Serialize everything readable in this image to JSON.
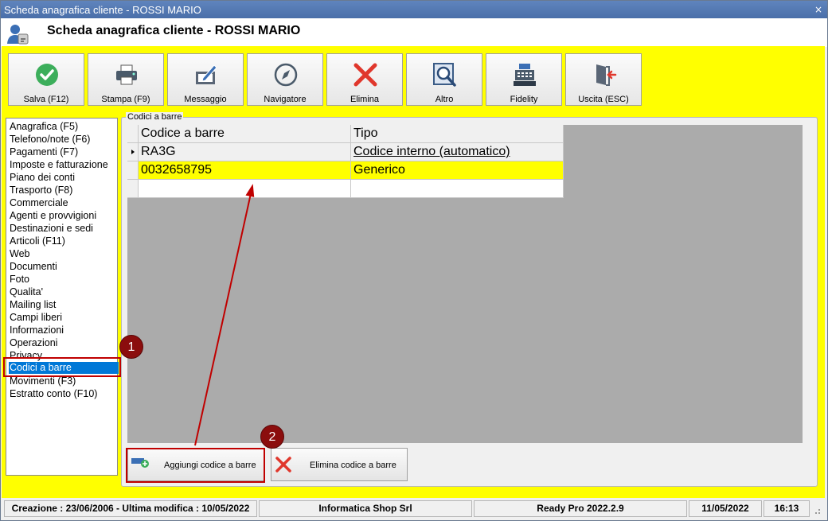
{
  "window": {
    "title": "Scheda anagrafica cliente - ROSSI MARIO",
    "close_glyph": "×"
  },
  "header": {
    "title": "Scheda anagrafica cliente - ROSSI MARIO"
  },
  "toolbar": {
    "save": "Salva (F12)",
    "print": "Stampa (F9)",
    "message": "Messaggio",
    "navigator": "Navigatore",
    "delete": "Elimina",
    "other": "Altro",
    "fidelity": "Fidelity",
    "exit": "Uscita (ESC)"
  },
  "menu": {
    "items": [
      "Anagrafica (F5)",
      "Telefono/note (F6)",
      "Pagamenti (F7)",
      "Imposte e fatturazione",
      "Piano dei conti",
      "Trasporto (F8)",
      "Commerciale",
      "Agenti e provvigioni",
      "Destinazioni e sedi",
      "Articoli (F11)",
      "Web",
      "Documenti",
      "Foto",
      "Qualita'",
      "Mailing list",
      "Campi liberi",
      "Informazioni",
      "Operazioni",
      "Privacy",
      "Codici a barre",
      "Movimenti (F3)",
      "Estratto conto (F10)"
    ],
    "selected_index": 19
  },
  "panel": {
    "group_label": "Codici a barre",
    "columns": [
      "Codice a barre",
      "Tipo"
    ],
    "rows": [
      {
        "code": "RA3G",
        "type": "Codice interno (automatico)"
      },
      {
        "code": "0032658795",
        "type": "Generico"
      }
    ],
    "add_button": "Aggiungi codice a barre",
    "delete_button": "Elimina codice a barre"
  },
  "annotations": {
    "step1": "1",
    "step2": "2"
  },
  "status": {
    "created": "Creazione : 23/06/2006 - Ultima modifica : 10/05/2022",
    "company": "Informatica Shop Srl",
    "version": "Ready Pro 2022.2.9",
    "date": "11/05/2022",
    "time": "16:13"
  },
  "colors": {
    "highlight": "#ffff00",
    "selection": "#0078d7",
    "annotation": "#c00000",
    "badge": "#8b0d0d"
  }
}
